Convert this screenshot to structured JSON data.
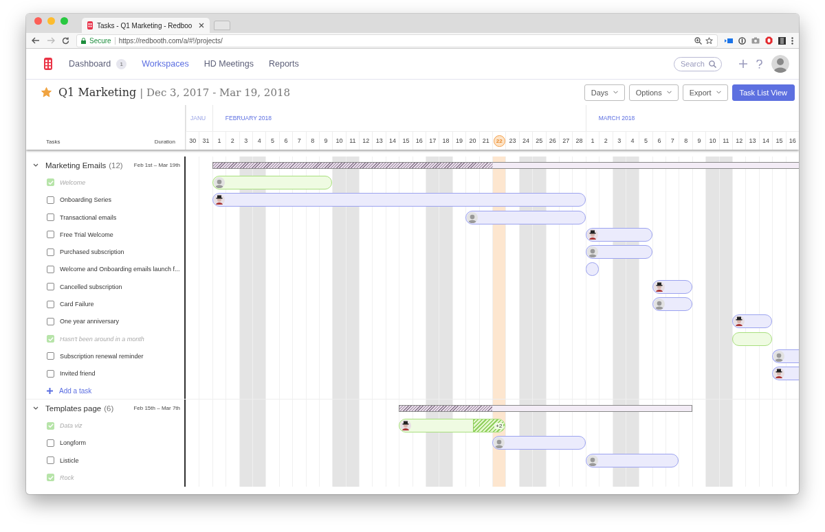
{
  "browser": {
    "tab_title": "Tasks - Q1 Marketing - Redboo",
    "secure_label": "Secure",
    "url": "https://redbooth.com/a/#!/projects/"
  },
  "nav": {
    "items": [
      {
        "label": "Dashboard",
        "badge": "1",
        "selected": false
      },
      {
        "label": "Workspaces",
        "selected": true
      },
      {
        "label": "HD Meetings",
        "selected": false
      },
      {
        "label": "Reports",
        "selected": false
      }
    ],
    "search": {
      "placeholder": "Search"
    }
  },
  "project": {
    "favorite": true,
    "name": "Q1 Marketing",
    "dates": "| Dec 3, 2017 - Mar 19, 2018",
    "buttons": [
      {
        "label": "Days",
        "kind": "dropdown"
      },
      {
        "label": "Options",
        "kind": "dropdown"
      },
      {
        "label": "Export",
        "kind": "dropdown"
      },
      {
        "label": "Task List View",
        "kind": "primary"
      }
    ]
  },
  "gantt": {
    "tasks_heading": "Tasks",
    "duration_heading": "Duration",
    "months": [
      {
        "label": "JANU",
        "dimmed": true
      },
      {
        "label": "FEBRUARY 2018",
        "dimmed": false
      },
      {
        "label": "MARCH 2018",
        "dimmed": false
      }
    ],
    "days": [
      {
        "label": "30",
        "weekend": false,
        "today": false
      },
      {
        "label": "31",
        "weekend": false,
        "today": false
      },
      {
        "label": "1",
        "weekend": false,
        "today": false
      },
      {
        "label": "2",
        "weekend": false,
        "today": false
      },
      {
        "label": "3",
        "weekend": true,
        "today": false
      },
      {
        "label": "4",
        "weekend": true,
        "today": false
      },
      {
        "label": "5",
        "weekend": false,
        "today": false
      },
      {
        "label": "6",
        "weekend": false,
        "today": false
      },
      {
        "label": "7",
        "weekend": false,
        "today": false
      },
      {
        "label": "8",
        "weekend": false,
        "today": false
      },
      {
        "label": "9",
        "weekend": false,
        "today": false
      },
      {
        "label": "10",
        "weekend": true,
        "today": false
      },
      {
        "label": "11",
        "weekend": true,
        "today": false
      },
      {
        "label": "12",
        "weekend": false,
        "today": false
      },
      {
        "label": "13",
        "weekend": false,
        "today": false
      },
      {
        "label": "14",
        "weekend": false,
        "today": false
      },
      {
        "label": "15",
        "weekend": false,
        "today": false
      },
      {
        "label": "16",
        "weekend": false,
        "today": false
      },
      {
        "label": "17",
        "weekend": true,
        "today": false
      },
      {
        "label": "18",
        "weekend": true,
        "today": false
      },
      {
        "label": "19",
        "weekend": false,
        "today": false
      },
      {
        "label": "20",
        "weekend": false,
        "today": false
      },
      {
        "label": "21",
        "weekend": false,
        "today": false
      },
      {
        "label": "22",
        "weekend": false,
        "today": true
      },
      {
        "label": "23",
        "weekend": false,
        "today": false
      },
      {
        "label": "24",
        "weekend": true,
        "today": false
      },
      {
        "label": "25",
        "weekend": true,
        "today": false
      },
      {
        "label": "26",
        "weekend": false,
        "today": false
      },
      {
        "label": "27",
        "weekend": false,
        "today": false
      },
      {
        "label": "28",
        "weekend": false,
        "today": false
      },
      {
        "label": "1",
        "weekend": false,
        "today": false
      },
      {
        "label": "2",
        "weekend": false,
        "today": false
      },
      {
        "label": "3",
        "weekend": true,
        "today": false
      },
      {
        "label": "4",
        "weekend": true,
        "today": false
      },
      {
        "label": "5",
        "weekend": false,
        "today": false
      },
      {
        "label": "6",
        "weekend": false,
        "today": false
      },
      {
        "label": "7",
        "weekend": false,
        "today": false
      },
      {
        "label": "8",
        "weekend": false,
        "today": false
      },
      {
        "label": "9",
        "weekend": false,
        "today": false
      },
      {
        "label": "10",
        "weekend": true,
        "today": false
      },
      {
        "label": "11",
        "weekend": true,
        "today": false
      },
      {
        "label": "12",
        "weekend": false,
        "today": false
      },
      {
        "label": "13",
        "weekend": false,
        "today": false
      },
      {
        "label": "14",
        "weekend": false,
        "today": false
      },
      {
        "label": "15",
        "weekend": false,
        "today": false
      },
      {
        "label": "16",
        "weekend": false,
        "today": false
      }
    ],
    "groups": [
      {
        "name": "Marketing Emails",
        "count": "(12)",
        "duration": "Feb 1st – Mar 19th",
        "expanded": true,
        "add_label": "Add a task",
        "tasks": [
          {
            "name": "Welcome",
            "checked": true,
            "kind": "plain"
          },
          {
            "name": "Onboarding Series",
            "checked": false,
            "kind": "hat"
          },
          {
            "name": "Transactional emails",
            "checked": false,
            "kind": "plain"
          },
          {
            "name": "Free Trial Welcome",
            "checked": false,
            "kind": "hat"
          },
          {
            "name": "Purchased subscription",
            "checked": false,
            "kind": "plain"
          },
          {
            "name": "Welcome and Onboarding emails launch f...",
            "checked": false,
            "kind": "bare"
          },
          {
            "name": "Cancelled subscription",
            "checked": false,
            "kind": "hat"
          },
          {
            "name": "Card Failure",
            "checked": false,
            "kind": "plain"
          },
          {
            "name": "One year anniversary",
            "checked": false,
            "kind": "hat"
          },
          {
            "name": "Hasn't been around in a month",
            "checked": true,
            "kind": "bare"
          },
          {
            "name": "Subscription renewal reminder",
            "checked": false,
            "kind": "plain"
          },
          {
            "name": "Invited friend",
            "checked": false,
            "kind": "hat"
          }
        ]
      },
      {
        "name": "Templates page",
        "count": "(6)",
        "duration": "Feb 15th – Mar 7th",
        "expanded": true,
        "tasks": [
          {
            "name": "Data viz",
            "checked": true,
            "kind": "hat",
            "overdue": true,
            "extra": "+2"
          },
          {
            "name": "Longform",
            "checked": false,
            "kind": "plain"
          },
          {
            "name": "Listicle",
            "checked": false,
            "kind": "plain"
          },
          {
            "name": "Rock",
            "checked": true,
            "kind": "bare"
          }
        ]
      }
    ]
  }
}
